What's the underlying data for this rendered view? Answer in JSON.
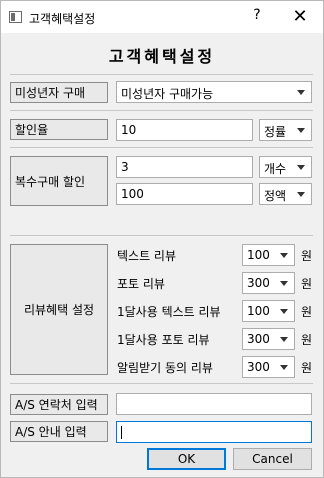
{
  "window": {
    "title": "고객혜택설정",
    "help": "?",
    "close": "✕"
  },
  "header": {
    "title": "고객혜택설정"
  },
  "minor": {
    "label": "미성년자 구매",
    "selected": "미성년자 구매가능"
  },
  "discount": {
    "label": "할인율",
    "value": "10",
    "type": "정률"
  },
  "multi": {
    "label": "복수구매 할인",
    "qty_value": "3",
    "qty_type": "개수",
    "amount_value": "100",
    "amount_type": "정액"
  },
  "review": {
    "label": "리뷰혜택 설정",
    "unit": "원",
    "rows": [
      {
        "label": "텍스트 리뷰",
        "value": "100"
      },
      {
        "label": "포토 리뷰",
        "value": "300"
      },
      {
        "label": "1달사용 텍스트 리뷰",
        "value": "100"
      },
      {
        "label": "1달사용 포토 리뷰",
        "value": "300"
      },
      {
        "label": "알림받기 동의 리뷰",
        "value": "300"
      }
    ]
  },
  "as_contact": {
    "label": "A/S 연락처 입력",
    "value": ""
  },
  "as_info": {
    "label": "A/S 안내 입력",
    "value": ""
  },
  "buttons": {
    "ok": "OK",
    "cancel": "Cancel"
  }
}
